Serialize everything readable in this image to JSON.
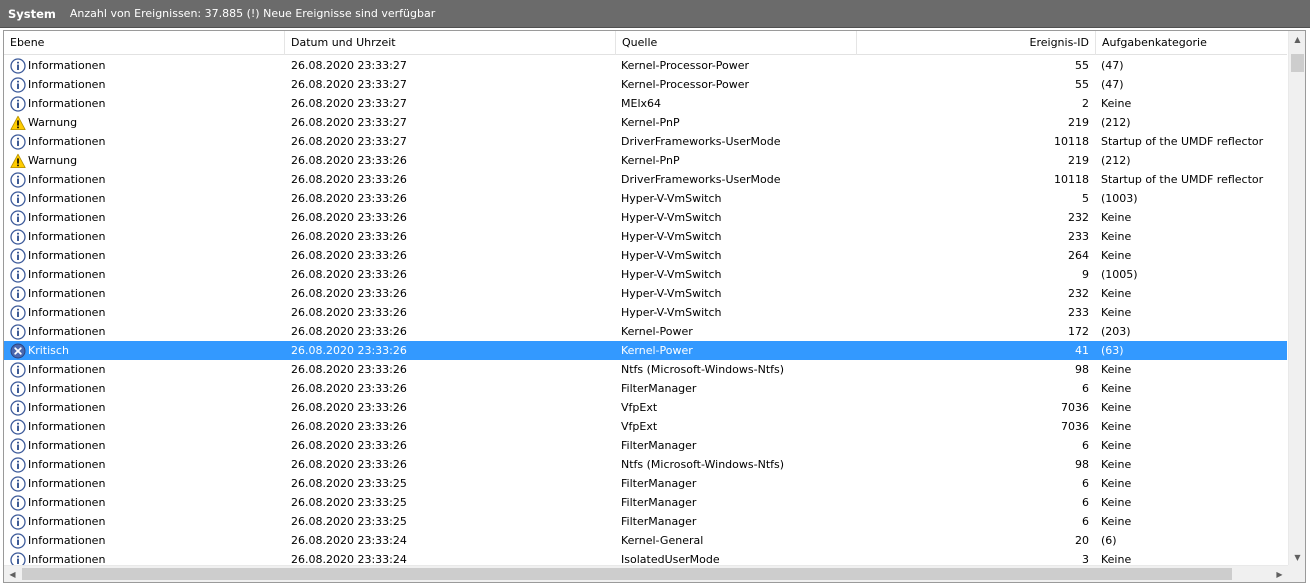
{
  "header": {
    "log_name": "System",
    "event_count_text": "Anzahl von Ereignissen: 37.885 (!) Neue Ereignisse sind verfügbar"
  },
  "columns": {
    "level": "Ebene",
    "date": "Datum und Uhrzeit",
    "source": "Quelle",
    "event_id": "Ereignis-ID",
    "task": "Aufgabenkategorie"
  },
  "icons": {
    "info": "info-icon",
    "warning": "warning-icon",
    "critical": "critical-icon"
  },
  "colors": {
    "selection": "#3399ff",
    "info_icon": "#3c5a9a",
    "warning_icon": "#ffcc00",
    "critical_icon": "#4a68b0"
  },
  "rows": [
    {
      "icon": "info",
      "level": "Informationen",
      "date": "26.08.2020 23:33:27",
      "source": "Kernel-Processor-Power",
      "event_id": "55",
      "task": "(47)"
    },
    {
      "icon": "info",
      "level": "Informationen",
      "date": "26.08.2020 23:33:27",
      "source": "Kernel-Processor-Power",
      "event_id": "55",
      "task": "(47)"
    },
    {
      "icon": "info",
      "level": "Informationen",
      "date": "26.08.2020 23:33:27",
      "source": "MElx64",
      "event_id": "2",
      "task": "Keine"
    },
    {
      "icon": "warning",
      "level": "Warnung",
      "date": "26.08.2020 23:33:27",
      "source": "Kernel-PnP",
      "event_id": "219",
      "task": "(212)"
    },
    {
      "icon": "info",
      "level": "Informationen",
      "date": "26.08.2020 23:33:27",
      "source": "DriverFrameworks-UserMode",
      "event_id": "10118",
      "task": "Startup of the UMDF reflector"
    },
    {
      "icon": "warning",
      "level": "Warnung",
      "date": "26.08.2020 23:33:26",
      "source": "Kernel-PnP",
      "event_id": "219",
      "task": "(212)"
    },
    {
      "icon": "info",
      "level": "Informationen",
      "date": "26.08.2020 23:33:26",
      "source": "DriverFrameworks-UserMode",
      "event_id": "10118",
      "task": "Startup of the UMDF reflector"
    },
    {
      "icon": "info",
      "level": "Informationen",
      "date": "26.08.2020 23:33:26",
      "source": "Hyper-V-VmSwitch",
      "event_id": "5",
      "task": "(1003)"
    },
    {
      "icon": "info",
      "level": "Informationen",
      "date": "26.08.2020 23:33:26",
      "source": "Hyper-V-VmSwitch",
      "event_id": "232",
      "task": "Keine"
    },
    {
      "icon": "info",
      "level": "Informationen",
      "date": "26.08.2020 23:33:26",
      "source": "Hyper-V-VmSwitch",
      "event_id": "233",
      "task": "Keine"
    },
    {
      "icon": "info",
      "level": "Informationen",
      "date": "26.08.2020 23:33:26",
      "source": "Hyper-V-VmSwitch",
      "event_id": "264",
      "task": "Keine"
    },
    {
      "icon": "info",
      "level": "Informationen",
      "date": "26.08.2020 23:33:26",
      "source": "Hyper-V-VmSwitch",
      "event_id": "9",
      "task": "(1005)"
    },
    {
      "icon": "info",
      "level": "Informationen",
      "date": "26.08.2020 23:33:26",
      "source": "Hyper-V-VmSwitch",
      "event_id": "232",
      "task": "Keine"
    },
    {
      "icon": "info",
      "level": "Informationen",
      "date": "26.08.2020 23:33:26",
      "source": "Hyper-V-VmSwitch",
      "event_id": "233",
      "task": "Keine"
    },
    {
      "icon": "info",
      "level": "Informationen",
      "date": "26.08.2020 23:33:26",
      "source": "Kernel-Power",
      "event_id": "172",
      "task": "(203)"
    },
    {
      "icon": "critical",
      "level": "Kritisch",
      "date": "26.08.2020 23:33:26",
      "source": "Kernel-Power",
      "event_id": "41",
      "task": "(63)",
      "selected": true
    },
    {
      "icon": "info",
      "level": "Informationen",
      "date": "26.08.2020 23:33:26",
      "source": "Ntfs (Microsoft-Windows-Ntfs)",
      "event_id": "98",
      "task": "Keine"
    },
    {
      "icon": "info",
      "level": "Informationen",
      "date": "26.08.2020 23:33:26",
      "source": "FilterManager",
      "event_id": "6",
      "task": "Keine"
    },
    {
      "icon": "info",
      "level": "Informationen",
      "date": "26.08.2020 23:33:26",
      "source": "VfpExt",
      "event_id": "7036",
      "task": "Keine"
    },
    {
      "icon": "info",
      "level": "Informationen",
      "date": "26.08.2020 23:33:26",
      "source": "VfpExt",
      "event_id": "7036",
      "task": "Keine"
    },
    {
      "icon": "info",
      "level": "Informationen",
      "date": "26.08.2020 23:33:26",
      "source": "FilterManager",
      "event_id": "6",
      "task": "Keine"
    },
    {
      "icon": "info",
      "level": "Informationen",
      "date": "26.08.2020 23:33:26",
      "source": "Ntfs (Microsoft-Windows-Ntfs)",
      "event_id": "98",
      "task": "Keine"
    },
    {
      "icon": "info",
      "level": "Informationen",
      "date": "26.08.2020 23:33:25",
      "source": "FilterManager",
      "event_id": "6",
      "task": "Keine"
    },
    {
      "icon": "info",
      "level": "Informationen",
      "date": "26.08.2020 23:33:25",
      "source": "FilterManager",
      "event_id": "6",
      "task": "Keine"
    },
    {
      "icon": "info",
      "level": "Informationen",
      "date": "26.08.2020 23:33:25",
      "source": "FilterManager",
      "event_id": "6",
      "task": "Keine"
    },
    {
      "icon": "info",
      "level": "Informationen",
      "date": "26.08.2020 23:33:24",
      "source": "Kernel-General",
      "event_id": "20",
      "task": "(6)"
    },
    {
      "icon": "info",
      "level": "Informationen",
      "date": "26.08.2020 23:33:24",
      "source": "IsolatedUserMode",
      "event_id": "3",
      "task": "Keine"
    }
  ]
}
